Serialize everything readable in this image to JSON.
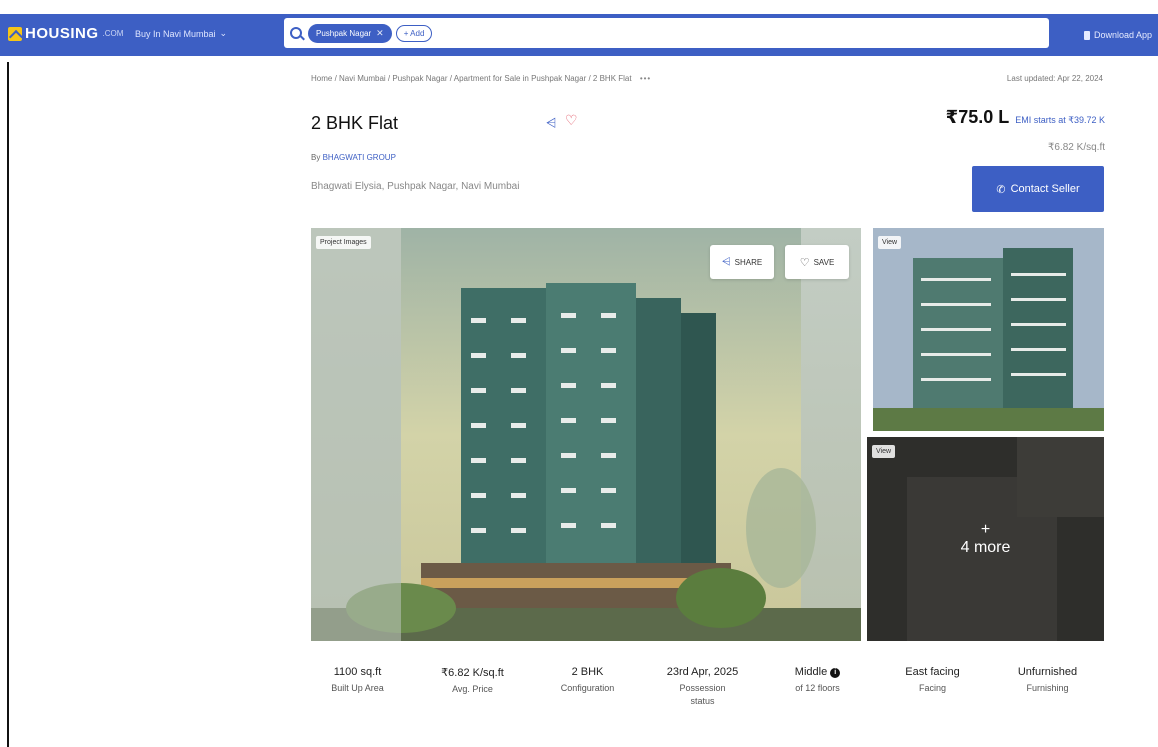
{
  "nav": {
    "logo_text": "HOUSING",
    "logo_domain": ".COM",
    "city_selector": "Buy In Navi Mumbai",
    "search_chip": "Pushpak Nagar",
    "add_label": "+ Add",
    "download_label": "Download App"
  },
  "breadcrumb": "Home / Navi Mumbai / Pushpak Nagar / Apartment for Sale in Pushpak Nagar / 2 BHK Flat",
  "breadcrumb_more": "•••",
  "last_updated": "Last updated: Apr 22, 2024",
  "listing": {
    "title": "2 BHK Flat",
    "by_prefix": "By",
    "developer": "BHAGWATI GROUP",
    "location": "Bhagwati Elysia, Pushpak Nagar, Navi Mumbai",
    "price": "₹75.0 L",
    "emi": "EMI starts at ₹39.72 K",
    "price_per_sqft": "₹6.82 K/sq.ft",
    "contact_label": "Contact Seller"
  },
  "gallery": {
    "main_tag": "Project Images",
    "share_label": "SHARE",
    "save_label": "SAVE",
    "side1_tag": "View",
    "side2_tag": "View",
    "more_plus": "+",
    "more_label": "4 more"
  },
  "stats": [
    {
      "value": "1100 sq.ft",
      "label": "Built Up Area"
    },
    {
      "value": "₹6.82 K/sq.ft",
      "label": "Avg. Price"
    },
    {
      "value": "2 BHK",
      "label": "Configuration"
    },
    {
      "value": "23rd Apr, 2025",
      "label": "Possession status"
    },
    {
      "value": "Middle",
      "label": "of 12 floors"
    },
    {
      "value": "East facing",
      "label": "Facing"
    },
    {
      "value": "Unfurnished",
      "label": "Furnishing"
    }
  ],
  "colors": {
    "brand_blue": "#3d5fc4",
    "logo_yellow": "#f5c518",
    "heart_red": "#e0505f"
  }
}
